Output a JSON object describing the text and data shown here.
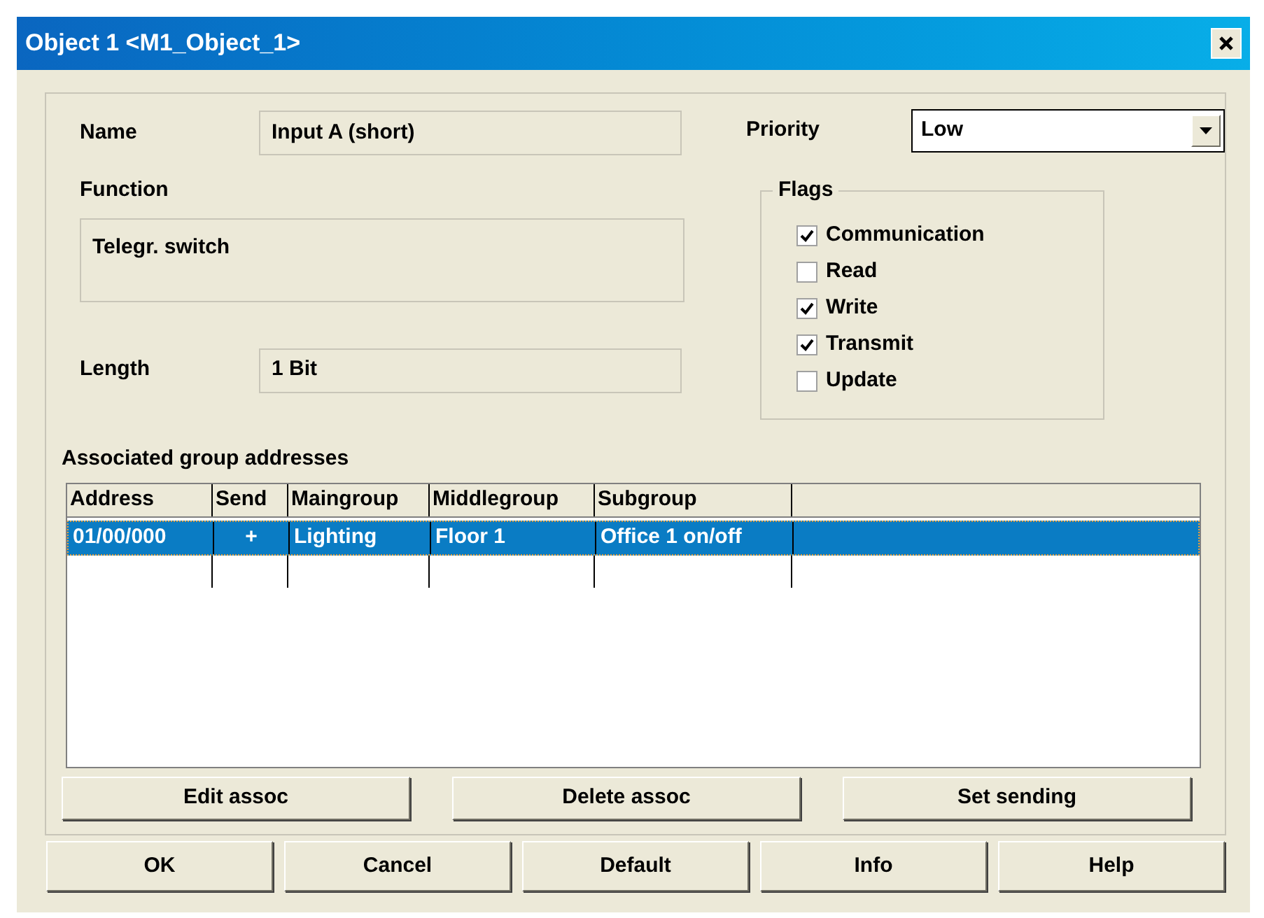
{
  "window": {
    "title": "Object 1 <M1_Object_1>"
  },
  "name": {
    "label": "Name",
    "value": "Input A (short)"
  },
  "priority": {
    "label": "Priority",
    "value": "Low"
  },
  "function": {
    "label": "Function",
    "value": "Telegr. switch"
  },
  "length": {
    "label": "Length",
    "value": "1 Bit"
  },
  "flags": {
    "title": "Flags",
    "items": [
      {
        "label": "Communication",
        "checked": true
      },
      {
        "label": "Read",
        "checked": false
      },
      {
        "label": "Write",
        "checked": true
      },
      {
        "label": "Transmit",
        "checked": true
      },
      {
        "label": "Update",
        "checked": false
      }
    ]
  },
  "group_addresses": {
    "label": "Associated group addresses",
    "columns": [
      "Address",
      "Send",
      "Maingroup",
      "Middlegroup",
      "Subgroup"
    ],
    "rows": [
      {
        "cells": [
          "01/00/000",
          "+",
          "Lighting",
          "Floor 1",
          "Office 1 on/off"
        ],
        "selected": true
      }
    ]
  },
  "assoc_buttons": [
    "Edit assoc",
    "Delete assoc",
    "Set sending"
  ],
  "buttons": [
    "OK",
    "Cancel",
    "Default",
    "Info",
    "Help"
  ]
}
